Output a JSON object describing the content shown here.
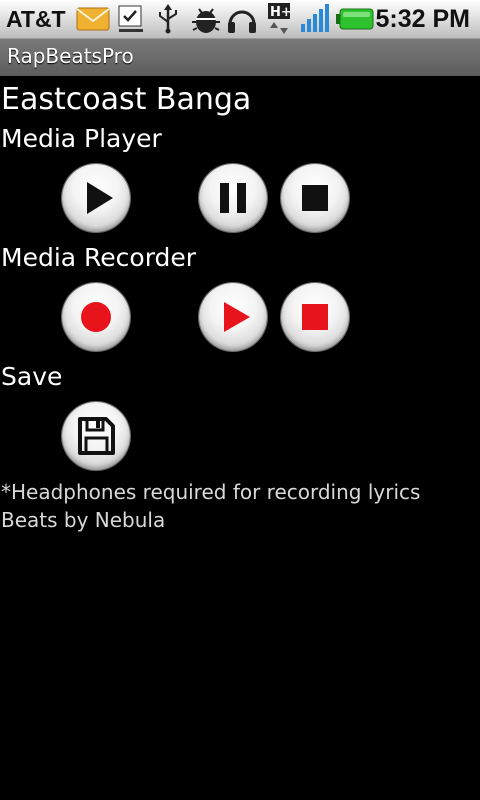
{
  "status_bar": {
    "carrier": "AT&T",
    "time": "5:32 PM",
    "icons": [
      "mail-icon",
      "download-done-icon",
      "usb-icon",
      "android-debug-icon",
      "headphones-icon",
      "hspa-data-icon",
      "signal-icon",
      "battery-icon"
    ],
    "battery_color": "#2fc22f",
    "signal_color": "#2a8ad8"
  },
  "app": {
    "title": "RapBeatsPro"
  },
  "content": {
    "song_title": "Eastcoast Banga",
    "media_player_heading": "Media Player",
    "media_recorder_heading": "Media Recorder",
    "save_heading": "Save",
    "note_headphones": "*Headphones required for recording lyrics",
    "credit": "Beats by Nebula"
  },
  "colors": {
    "record_red": "#e8141c",
    "icon_dark": "#111111"
  }
}
